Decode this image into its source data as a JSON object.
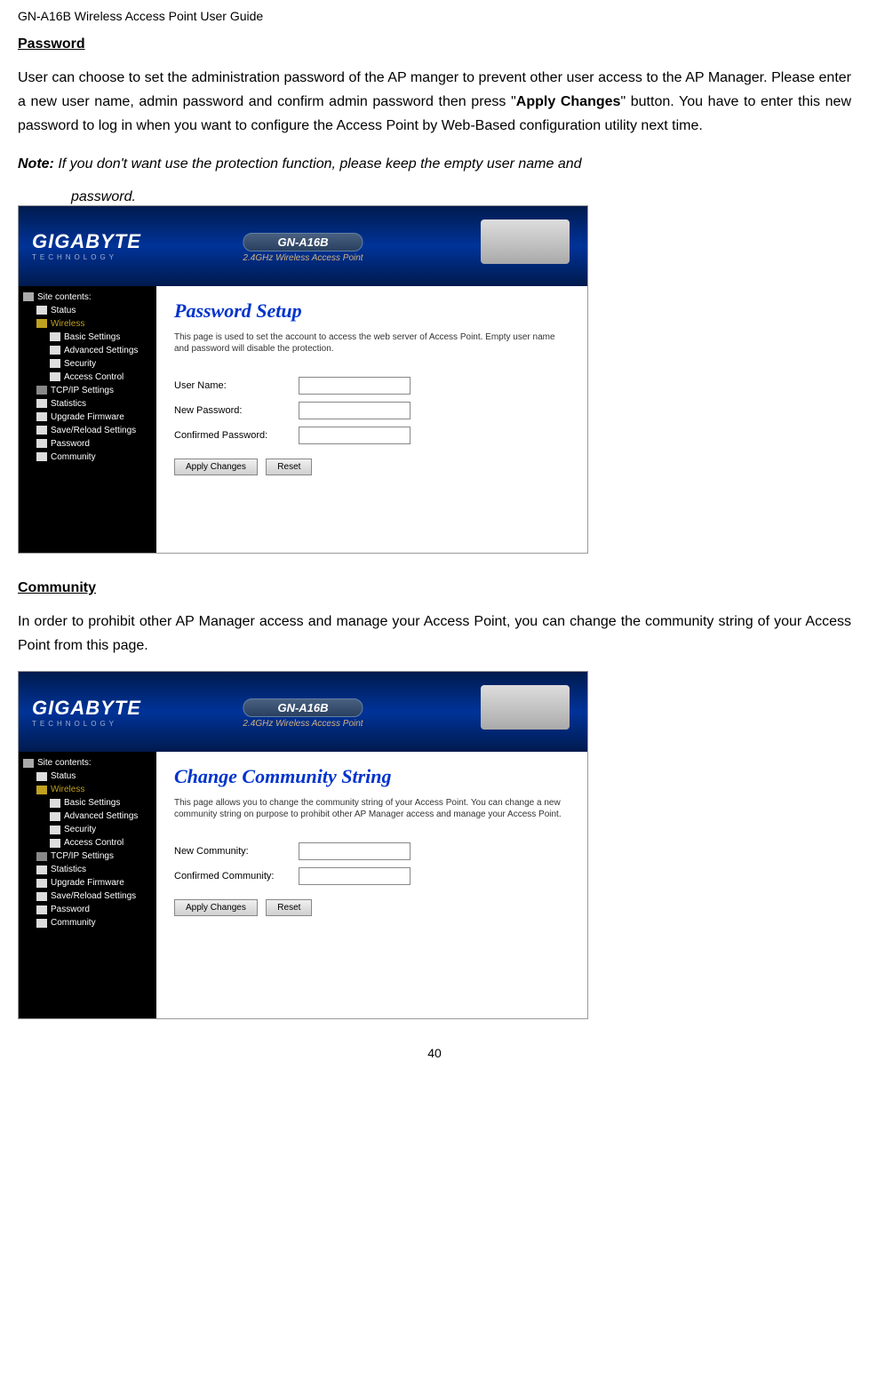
{
  "doc": {
    "header": "GN-A16B Wireless Access Point  User Guide",
    "page_number": "40"
  },
  "sections": {
    "password": {
      "title": "Password",
      "body": "User can choose to set the administration password of the AP manger to prevent other user access to the AP Manager. Please enter a new user name, admin password and confirm admin password then press \"",
      "body_bold": "Apply Changes",
      "body_after": "\" button. You have to enter this new password to log in when you want to configure the Access Point by Web-Based configuration utility next time.",
      "note_label": "Note:",
      "note_body": "If you don't want use the protection function, please keep the empty user name and",
      "note_indent": "password."
    },
    "community": {
      "title": "Community",
      "body": "In order to prohibit other AP Manager access and manage your Access Point, you can change the community string of your Access Point from this page."
    }
  },
  "screenshot1": {
    "brand": "GIGABYTE",
    "brand_sub": "TECHNOLOGY",
    "model": "GN-A16B",
    "model_desc": "2.4GHz Wireless Access Point",
    "sidebar": {
      "root": "Site contents:",
      "items": [
        "Status",
        "Wireless",
        "Basic Settings",
        "Advanced Settings",
        "Security",
        "Access Control",
        "TCP/IP Settings",
        "Statistics",
        "Upgrade Firmware",
        "Save/Reload Settings",
        "Password",
        "Community"
      ]
    },
    "pane": {
      "title": "Password Setup",
      "desc": "This page is used to set the account to access the web server of Access Point. Empty user name and password will disable the protection.",
      "field1": "User Name:",
      "field2": "New Password:",
      "field3": "Confirmed Password:",
      "btn1": "Apply Changes",
      "btn2": "Reset"
    }
  },
  "screenshot2": {
    "brand": "GIGABYTE",
    "brand_sub": "TECHNOLOGY",
    "model": "GN-A16B",
    "model_desc": "2.4GHz Wireless Access Point",
    "sidebar": {
      "root": "Site contents:",
      "items": [
        "Status",
        "Wireless",
        "Basic Settings",
        "Advanced Settings",
        "Security",
        "Access Control",
        "TCP/IP Settings",
        "Statistics",
        "Upgrade Firmware",
        "Save/Reload Settings",
        "Password",
        "Community"
      ]
    },
    "pane": {
      "title": "Change Community String",
      "desc": "This page allows you to change the community string of your Access Point. You can change a new community string on purpose to prohibit other AP Manager access and manage your Access Point.",
      "field1": "New Community:",
      "field2": "Confirmed Community:",
      "btn1": "Apply Changes",
      "btn2": "Reset"
    }
  }
}
